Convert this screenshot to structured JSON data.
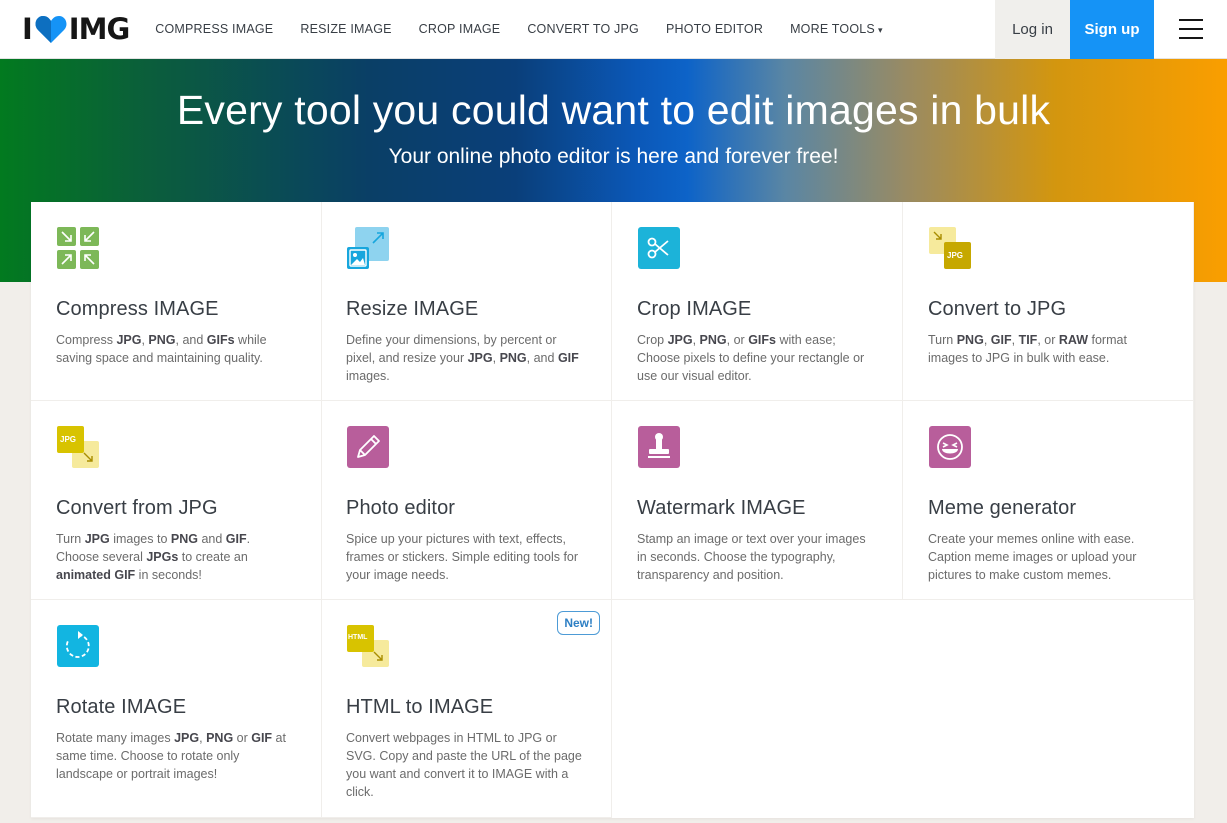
{
  "header": {
    "logo_left": "I",
    "logo_right": "IMG",
    "nav": [
      {
        "label": "COMPRESS IMAGE"
      },
      {
        "label": "RESIZE IMAGE"
      },
      {
        "label": "CROP IMAGE"
      },
      {
        "label": "CONVERT TO JPG"
      },
      {
        "label": "PHOTO EDITOR"
      },
      {
        "label": "MORE TOOLS"
      }
    ],
    "more_caret": "▾",
    "login_label": "Log in",
    "signup_label": "Sign up"
  },
  "hero": {
    "title": "Every tool you could want to edit images in bulk",
    "subtitle": "Your online photo editor is here and forever free!"
  },
  "colors": {
    "signup": "#1593f6",
    "compress": "#7db858",
    "resize": "#8ed3ef",
    "crop": "#1cb3d9",
    "convert": "#d8c300",
    "photo_editor": "#b85e9b",
    "watermark": "#b85e9b",
    "meme": "#b85e9b",
    "rotate": "#12b5e1",
    "html": "#d8c300"
  },
  "tools": [
    {
      "title": "Compress IMAGE",
      "icon": "compress-icon",
      "desc": [
        {
          "t": "Compress "
        },
        {
          "b": "JPG"
        },
        {
          "t": ", "
        },
        {
          "b": "PNG"
        },
        {
          "t": ", and "
        },
        {
          "b": "GIFs"
        },
        {
          "t": " while saving space and maintaining quality."
        }
      ]
    },
    {
      "title": "Resize IMAGE",
      "icon": "resize-icon",
      "desc": [
        {
          "t": "Define your dimensions, by percent or pixel, and resize your "
        },
        {
          "b": "JPG"
        },
        {
          "t": ", "
        },
        {
          "b": "PNG"
        },
        {
          "t": ", and "
        },
        {
          "b": "GIF"
        },
        {
          "t": " images."
        }
      ]
    },
    {
      "title": "Crop IMAGE",
      "icon": "scissors-icon",
      "desc": [
        {
          "t": "Crop "
        },
        {
          "b": "JPG"
        },
        {
          "t": ", "
        },
        {
          "b": "PNG"
        },
        {
          "t": ", or "
        },
        {
          "b": "GIFs"
        },
        {
          "t": " with ease; Choose pixels to define your rectangle or use our visual editor."
        }
      ]
    },
    {
      "title": "Convert to JPG",
      "icon": "convert-to-jpg-icon",
      "icon_text": "JPG",
      "desc": [
        {
          "t": "Turn "
        },
        {
          "b": "PNG"
        },
        {
          "t": ", "
        },
        {
          "b": "GIF"
        },
        {
          "t": ", "
        },
        {
          "b": "TIF"
        },
        {
          "t": ", or "
        },
        {
          "b": "RAW"
        },
        {
          "t": " format images to JPG in bulk with ease."
        }
      ]
    },
    {
      "title": "Convert from JPG",
      "icon": "convert-from-jpg-icon",
      "icon_text": "JPG",
      "desc": [
        {
          "t": "Turn "
        },
        {
          "b": "JPG"
        },
        {
          "t": " images to "
        },
        {
          "b": "PNG"
        },
        {
          "t": " and "
        },
        {
          "b": "GIF"
        },
        {
          "t": ". Choose several "
        },
        {
          "b": "JPGs"
        },
        {
          "t": " to create an "
        },
        {
          "b": "animated GIF"
        },
        {
          "t": " in seconds!"
        }
      ]
    },
    {
      "title": "Photo editor",
      "icon": "pencil-icon",
      "desc": [
        {
          "t": "Spice up your pictures with text, effects, frames or stickers. Simple editing tools for your image needs."
        }
      ]
    },
    {
      "title": "Watermark IMAGE",
      "icon": "stamp-icon",
      "desc": [
        {
          "t": "Stamp an image or text over your images in seconds. Choose the typography, transparency and position."
        }
      ]
    },
    {
      "title": "Meme generator",
      "icon": "laughing-face-icon",
      "desc": [
        {
          "t": "Create your memes online with ease. Caption meme images or upload your pictures to make custom memes."
        }
      ]
    },
    {
      "title": "Rotate IMAGE",
      "icon": "rotate-icon",
      "desc": [
        {
          "t": "Rotate many images "
        },
        {
          "b": "JPG"
        },
        {
          "t": ", "
        },
        {
          "b": "PNG"
        },
        {
          "t": " or "
        },
        {
          "b": "GIF"
        },
        {
          "t": " at same time. Choose to rotate only landscape or portrait images!"
        }
      ]
    },
    {
      "title": "HTML to IMAGE",
      "icon": "html-to-image-icon",
      "icon_text": "HTML",
      "badge": "New!",
      "desc": [
        {
          "t": "Convert webpages in HTML to JPG or SVG. Copy and paste the URL of the page you want and convert it to IMAGE with a click."
        }
      ]
    }
  ]
}
